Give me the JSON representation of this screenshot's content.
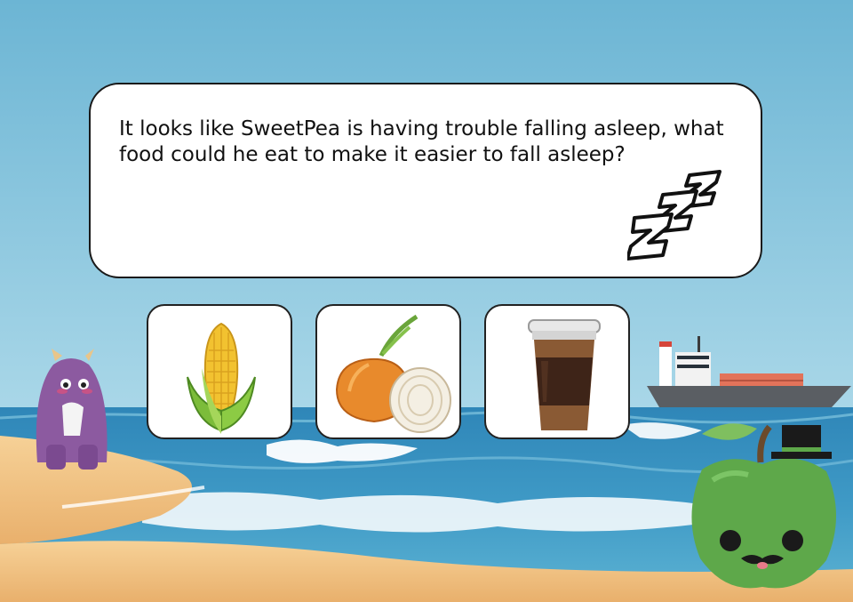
{
  "question": {
    "text": "It looks like SweetPea is having trouble falling asleep, what food could he eat to make it easier to fall asleep?"
  },
  "answer_choices": [
    {
      "id": "corn",
      "icon": "corn-icon"
    },
    {
      "id": "onion",
      "icon": "onion-icon"
    },
    {
      "id": "coffee",
      "icon": "coffee-cup-icon"
    }
  ],
  "characters": [
    {
      "name": "purple-monster",
      "icon": "purple-monster-icon"
    },
    {
      "name": "green-apple-mascot",
      "icon": "apple-mascot-icon"
    }
  ],
  "colors": {
    "sky": "#74bcd6",
    "sea": "#3c93bf",
    "sand": "#f3c98a",
    "monster": "#8c5aa0",
    "apple": "#5ea84a"
  }
}
